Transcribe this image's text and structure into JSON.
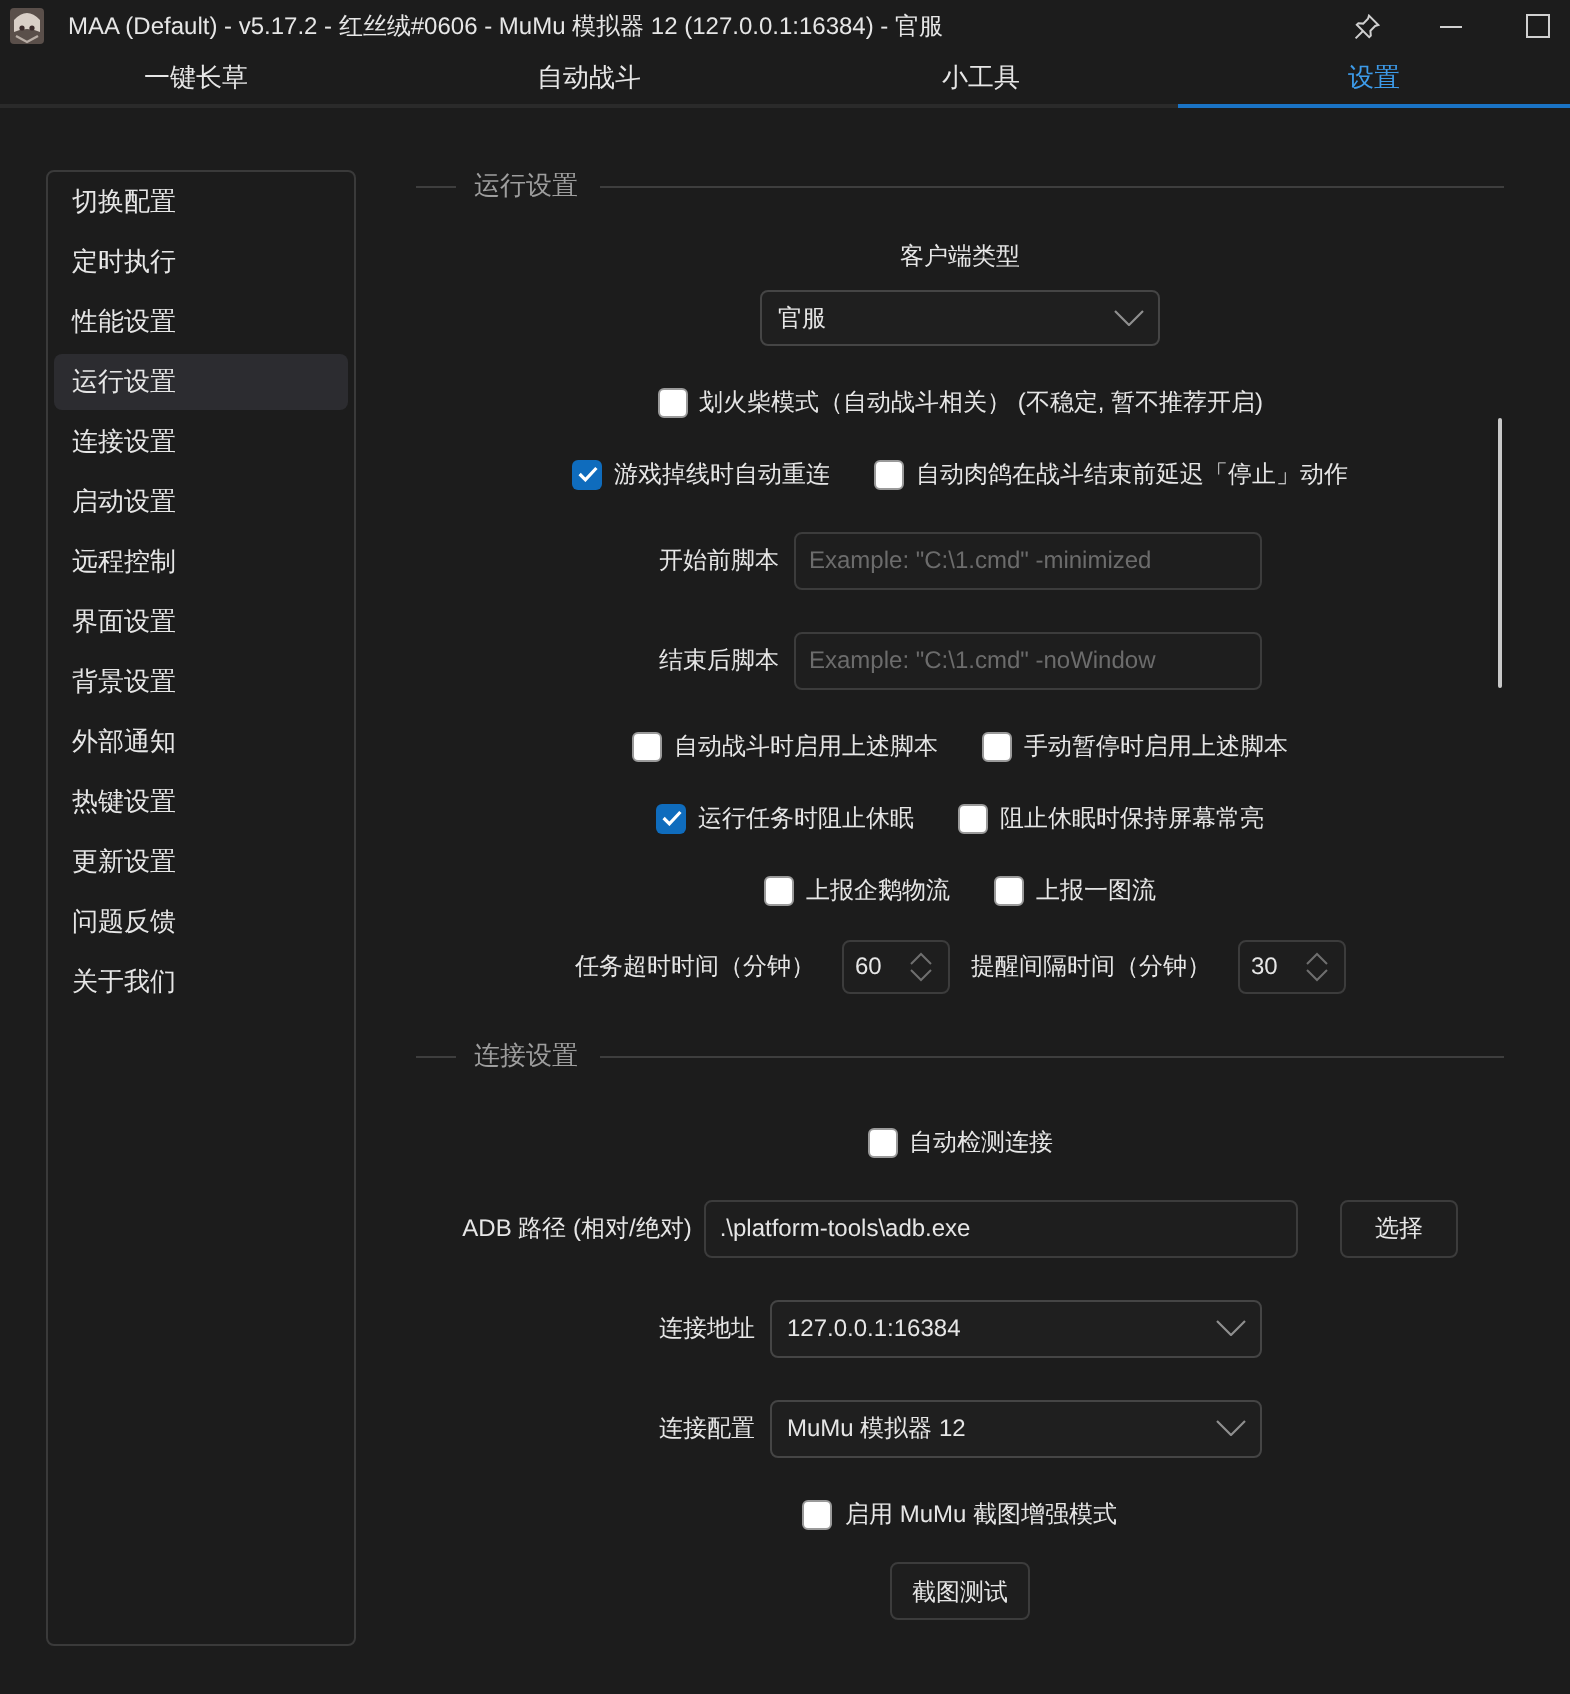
{
  "window": {
    "title": "MAA (Default) - v5.17.2 - 红丝绒#0606 - MuMu 模拟器 12 (127.0.0.1:16384) - 官服"
  },
  "tabs": [
    {
      "label": "一键长草",
      "selected": false
    },
    {
      "label": "自动战斗",
      "selected": false
    },
    {
      "label": "小工具",
      "selected": false
    },
    {
      "label": "设置",
      "selected": true
    }
  ],
  "sidebar": {
    "items": [
      {
        "label": "切换配置",
        "selected": false
      },
      {
        "label": "定时执行",
        "selected": false
      },
      {
        "label": "性能设置",
        "selected": false
      },
      {
        "label": "运行设置",
        "selected": true
      },
      {
        "label": "连接设置",
        "selected": false
      },
      {
        "label": "启动设置",
        "selected": false
      },
      {
        "label": "远程控制",
        "selected": false
      },
      {
        "label": "界面设置",
        "selected": false
      },
      {
        "label": "背景设置",
        "selected": false
      },
      {
        "label": "外部通知",
        "selected": false
      },
      {
        "label": "热键设置",
        "selected": false
      },
      {
        "label": "更新设置",
        "selected": false
      },
      {
        "label": "问题反馈",
        "selected": false
      },
      {
        "label": "关于我们",
        "selected": false
      }
    ]
  },
  "sections": [
    {
      "title": "运行设置",
      "rows": [
        {
          "kind": "stacked_select",
          "label": "客户端类型",
          "value": "官服"
        },
        {
          "kind": "checkboxes",
          "items": [
            {
              "label": "划火柴模式（自动战斗相关） (不稳定, 暂不推荐开启)",
              "checked": false
            }
          ]
        },
        {
          "kind": "checkboxes",
          "items": [
            {
              "label": "游戏掉线时自动重连",
              "checked": true
            },
            {
              "label": "自动肉鸽在战斗结束前延迟「停止」动作",
              "checked": false
            }
          ]
        },
        {
          "kind": "text_field",
          "label": "开始前脚本",
          "placeholder": "Example: \"C:\\1.cmd\" -minimized"
        },
        {
          "kind": "text_field",
          "label": "结束后脚本",
          "placeholder": "Example: \"C:\\1.cmd\" -noWindow"
        },
        {
          "kind": "checkboxes",
          "items": [
            {
              "label": "自动战斗时启用上述脚本",
              "checked": false
            },
            {
              "label": "手动暂停时启用上述脚本",
              "checked": false
            }
          ]
        },
        {
          "kind": "checkboxes",
          "items": [
            {
              "label": "运行任务时阻止休眠",
              "checked": true
            },
            {
              "label": "阻止休眠时保持屏幕常亮",
              "checked": false
            }
          ]
        },
        {
          "kind": "checkboxes",
          "items": [
            {
              "label": "上报企鹅物流",
              "checked": false
            },
            {
              "label": "上报一图流",
              "checked": false
            }
          ]
        },
        {
          "kind": "spinboxes",
          "items": [
            {
              "label": "任务超时时间（分钟）",
              "value": "60"
            },
            {
              "label": "提醒间隔时间（分钟）",
              "value": "30"
            }
          ]
        }
      ]
    },
    {
      "title": "连接设置",
      "rows": [
        {
          "kind": "checkboxes",
          "items": [
            {
              "label": "自动检测连接",
              "checked": false
            }
          ]
        },
        {
          "kind": "path_field",
          "label": "ADB 路径 (相对/绝对)",
          "value": ".\\platform-tools\\adb.exe",
          "button": "选择"
        },
        {
          "kind": "select",
          "label": "连接地址",
          "value": "127.0.0.1:16384"
        },
        {
          "kind": "select",
          "label": "连接配置",
          "value": "MuMu 模拟器 12"
        },
        {
          "kind": "checkboxes",
          "items": [
            {
              "label": "启用 MuMu 截图增强模式",
              "checked": false
            }
          ]
        },
        {
          "kind": "button",
          "label": "截图测试"
        }
      ]
    }
  ]
}
